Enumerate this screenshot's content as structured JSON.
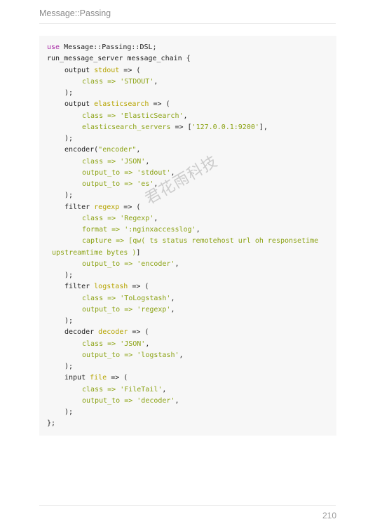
{
  "header": {
    "title": "Message::Passing"
  },
  "watermark": "君花雨科技",
  "footer": {
    "page_number": "210"
  },
  "code": {
    "l01": {
      "kw": "use",
      "t": " Message::Passing::DSL;"
    },
    "l02": "run_message_server message_chain {",
    "l03": {
      "a": "output ",
      "b": "stdout",
      "c": " => ("
    },
    "l04": {
      "a": "class => ",
      "s": "'STDOUT'",
      "c": ","
    },
    "l05": ");",
    "l06": {
      "a": "output ",
      "b": "elasticsearch",
      "c": " => ("
    },
    "l07": {
      "a": "class => ",
      "s": "'ElasticSearch'",
      "c": ","
    },
    "l08": {
      "b": "elasticsearch_servers",
      "a": " => [",
      "s": "'127.0.0.1:9200'",
      "c": "],"
    },
    "l09": ");",
    "l10": {
      "a": "encoder(",
      "s": "\"encoder\"",
      "c": ","
    },
    "l11": {
      "a": "class => ",
      "s": "'JSON'",
      "c": ","
    },
    "l12": {
      "a": "output_to => ",
      "s": "'stdout'",
      "c": ","
    },
    "l13": {
      "a": "output_to => ",
      "s": "'es'",
      "c": ","
    },
    "l14": ");",
    "l15": {
      "a": "filter ",
      "b": "regexp",
      "c": " => ("
    },
    "l16": {
      "a": "class => ",
      "s": "'Regexp'",
      "c": ","
    },
    "l17": {
      "a": "format => ",
      "s": "':nginxaccesslog'",
      "c": ","
    },
    "l18": {
      "a": "capture => [",
      "s": "qw( ts status remotehost url oh responsetime"
    },
    "l19": {
      "s": "upstreamtime bytes )",
      "c": "]"
    },
    "l20": {
      "a": "output_to => ",
      "s": "'encoder'",
      "c": ","
    },
    "l21": ");",
    "l22": {
      "a": "filter ",
      "b": "logstash",
      "c": " => ("
    },
    "l23": {
      "a": "class => ",
      "s": "'ToLogstash'",
      "c": ","
    },
    "l24": {
      "a": "output_to => ",
      "s": "'regexp'",
      "c": ","
    },
    "l25": ");",
    "l26": {
      "a": "decoder ",
      "b": "decoder",
      "c": " => ("
    },
    "l27": {
      "a": "class => ",
      "s": "'JSON'",
      "c": ","
    },
    "l28": {
      "a": "output_to => ",
      "s": "'logstash'",
      "c": ","
    },
    "l29": ");",
    "l30": {
      "a": "input ",
      "b": "file",
      "c": " => ("
    },
    "l31": {
      "a": "class => ",
      "s": "'FileTail'",
      "c": ","
    },
    "l32": {
      "a": "output_to => ",
      "s": "'decoder'",
      "c": ","
    },
    "l33": ");",
    "l34": "};"
  }
}
